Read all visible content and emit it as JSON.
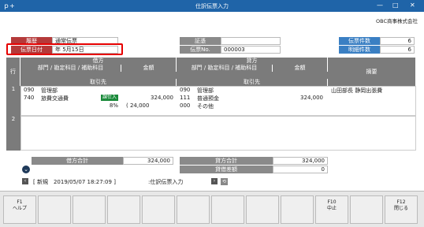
{
  "window": {
    "title": "仕訳伝票入力",
    "menu_glyph": "ｐ+",
    "min": "—",
    "max": "□",
    "close": "✕"
  },
  "company": "OBC商事株式会社",
  "header": {
    "rireki_label": "履歴",
    "rireki_value": "通常伝票",
    "date_label": "伝票日付",
    "date_value": "年  5月15日",
    "shoshou_label": "証憑",
    "shoshou_value": "",
    "no_label": "伝票No.",
    "no_value": "000003",
    "count_label": "伝票件数",
    "count_value": "6",
    "detail_label": "明細件数",
    "detail_value": "6"
  },
  "grid": {
    "row_label": "行",
    "debit": "借方",
    "credit": "貸方",
    "dept_acct": "部門 / 勘定科目 / 補助科目",
    "amount": "金額",
    "partner": "取引先",
    "memo": "摘要",
    "rows": [
      {
        "num": "1",
        "d_dept_code": "090",
        "d_dept": "管理部",
        "d_acct_code": "740",
        "d_acct": "旅費交通費",
        "d_tax_badge": "課仕入",
        "d_amount": "324,000",
        "d_rate": "8%",
        "d_tax": "( 24,000",
        "c_dept_code": "090",
        "c_dept": "管理部",
        "c_acct_code": "111",
        "c_acct": "普通預金",
        "c_amount": "324,000",
        "c_sub_code": "000",
        "c_sub": "その他",
        "memo": "山田部長 静岡出張費"
      },
      {
        "num": "2"
      }
    ]
  },
  "totals": {
    "debit_total_label": "借方合計",
    "debit_total": "324,000",
    "credit_total_label": "貸方合計",
    "credit_total": "324,000",
    "diff_label": "貸借差額",
    "diff": "0"
  },
  "status": {
    "text": "[ 新規　2019/05/07 18:27:09 ]",
    "program": ":仕訳伝票入力",
    "fwd": "›",
    "back": "‹",
    "refresh": "⟲",
    "down": "⌄"
  },
  "fkeys": [
    {
      "key": "F1",
      "label": "ヘルプ"
    },
    {
      "key": "",
      "label": ""
    },
    {
      "key": "",
      "label": ""
    },
    {
      "key": "",
      "label": ""
    },
    {
      "key": "",
      "label": ""
    },
    {
      "key": "",
      "label": ""
    },
    {
      "key": "",
      "label": ""
    },
    {
      "key": "",
      "label": ""
    },
    {
      "key": "",
      "label": ""
    },
    {
      "key": "F10",
      "label": "中止"
    },
    {
      "key": "",
      "label": ""
    },
    {
      "key": "F12",
      "label": "閉じる"
    }
  ]
}
